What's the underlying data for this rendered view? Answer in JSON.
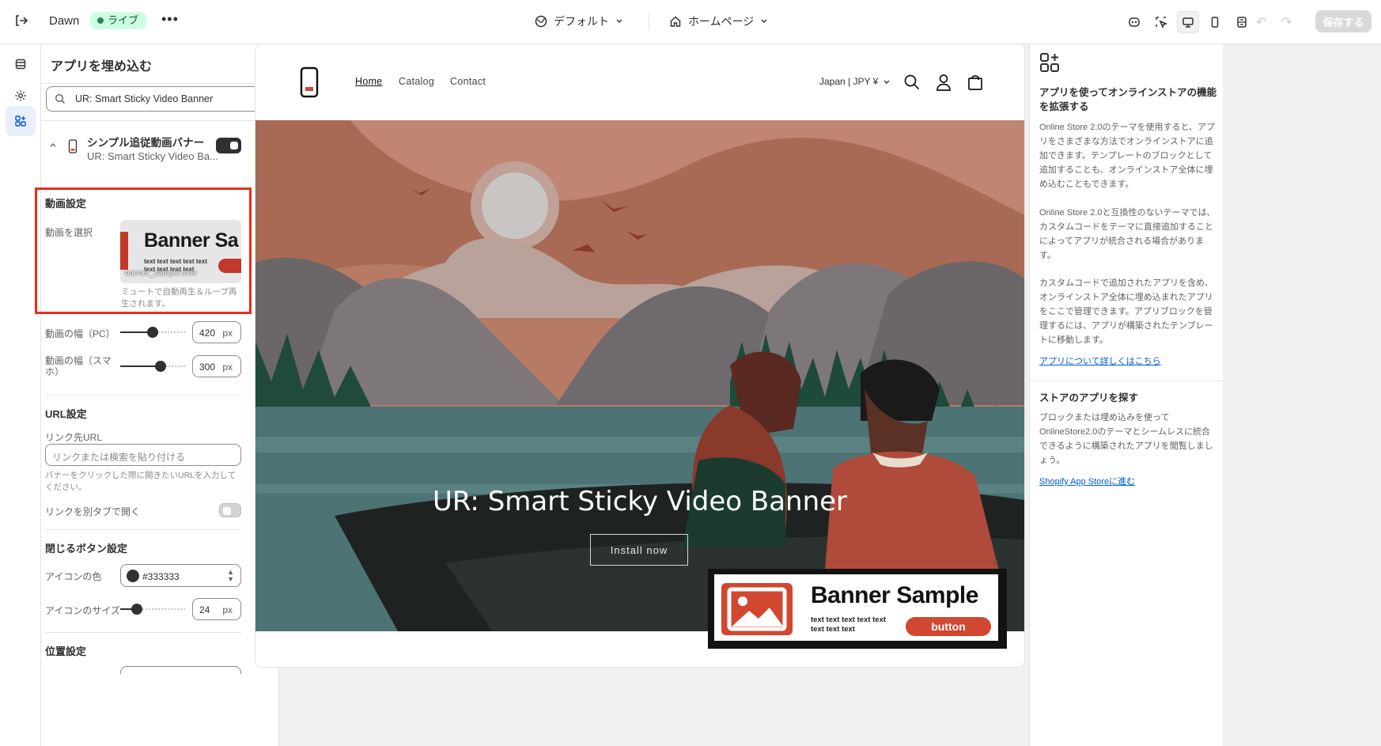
{
  "topbar": {
    "theme_name": "Dawn",
    "live_label": "ライブ",
    "more_label": "•••",
    "template_label": "デフォルト",
    "page_label": "ホームページ",
    "save_label": "保存する",
    "undo_label": "↶",
    "redo_label": "↷"
  },
  "panel": {
    "title": "アプリを埋め込む",
    "search_value": "UR: Smart Sticky Video Banner",
    "app": {
      "name": "シンプル追従動画バナー",
      "subtitle": "UR: Smart Sticky Video Ba...",
      "enabled": true,
      "chevron": "^"
    },
    "video_section": {
      "heading": "動画設定",
      "select_label": "動画を選択",
      "thumb_title": "Banner Sa",
      "thumb_text": "text text text text text text text text text",
      "file_name": "banner_sample.mov",
      "help": "ミュートで自動再生＆ループ再生されます。",
      "width_pc_label": "動画の幅（PC）",
      "width_pc_value": "420",
      "width_pc_fraction": 0.5,
      "width_sp_label": "動画の幅（スマホ）",
      "width_sp_value": "300",
      "width_sp_fraction": 0.65,
      "unit": "px"
    },
    "url_section": {
      "heading": "URL設定",
      "link_label": "リンク先URL",
      "link_placeholder": "リンクまたは検索を貼り付ける",
      "link_help": "バナーをクリックした際に開きたいURLを入力してください。",
      "new_tab_label": "リンクを別タブで開く",
      "new_tab_enabled": false
    },
    "close_section": {
      "heading": "閉じるボタン設定",
      "icon_color_label": "アイコンの色",
      "icon_color_value": "#333333",
      "icon_size_label": "アイコンのサイズ",
      "icon_size_value": "24",
      "icon_size_fraction": 0.2,
      "unit": "px"
    },
    "position_section": {
      "heading": "位置設定"
    }
  },
  "preview": {
    "nav": [
      "Home",
      "Catalog",
      "Contact"
    ],
    "locale": "Japan | JPY ¥",
    "hero_title": "UR: Smart Sticky Video Banner",
    "install_label": "Install now",
    "sticky_banner": {
      "close": "×",
      "title": "Banner Sample",
      "text": "text text text text text text text text",
      "button": "button"
    }
  },
  "right_panel": {
    "heading": "アプリを使ってオンラインストアの機能を拡張する",
    "p1": "Online Store 2.0のテーマを使用すると、アプリをさまざまな方法でオンラインストアに追加できます。テンプレートのブロックとして追加することも、オンラインストア全体に埋め込むこともできます。",
    "p2": "Online Store 2.0と互換性のないテーマでは、カスタムコードをテーマに直接追加することによってアプリが統合される場合があります。",
    "p3": "カスタムコードで追加されたアプリを含め、オンラインストア全体に埋め込まれたアプリをここで管理できます。アプリブロックを管理するには、アプリが構築されたテンプレートに移動します。",
    "link1": "アプリについて詳しくはこちら",
    "heading2": "ストアのアプリを探す",
    "p4": "ブロックまたは埋め込みを使ってOnlineStore2.0のテーマとシームレスに統合できるように構築されたアプリを閲覧しましょう。",
    "link2": "Shopify App Storeに進む"
  },
  "colors": {
    "accent": "#303030",
    "live_bg": "#cdfee1",
    "highlight": "#ef2a1f",
    "banner_red": "#d1472f",
    "link": "#005bd3"
  }
}
